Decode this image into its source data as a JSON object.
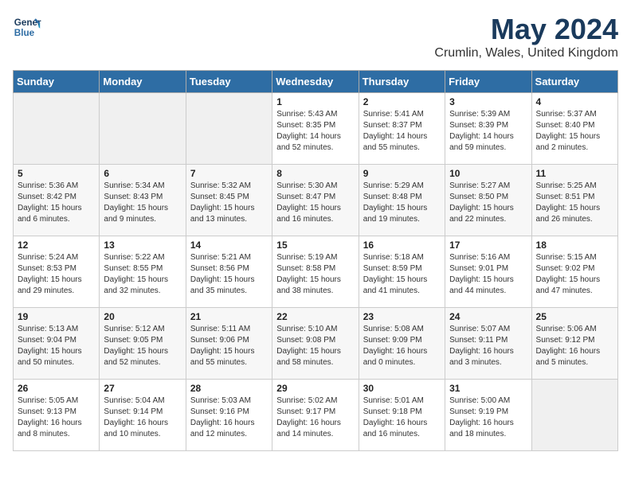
{
  "header": {
    "logo_line1": "General",
    "logo_line2": "Blue",
    "month": "May 2024",
    "location": "Crumlin, Wales, United Kingdom"
  },
  "weekdays": [
    "Sunday",
    "Monday",
    "Tuesday",
    "Wednesday",
    "Thursday",
    "Friday",
    "Saturday"
  ],
  "weeks": [
    [
      {
        "day": "",
        "empty": true
      },
      {
        "day": "",
        "empty": true
      },
      {
        "day": "",
        "empty": true
      },
      {
        "day": "1",
        "sunrise": "Sunrise: 5:43 AM",
        "sunset": "Sunset: 8:35 PM",
        "daylight": "Daylight: 14 hours and 52 minutes."
      },
      {
        "day": "2",
        "sunrise": "Sunrise: 5:41 AM",
        "sunset": "Sunset: 8:37 PM",
        "daylight": "Daylight: 14 hours and 55 minutes."
      },
      {
        "day": "3",
        "sunrise": "Sunrise: 5:39 AM",
        "sunset": "Sunset: 8:39 PM",
        "daylight": "Daylight: 14 hours and 59 minutes."
      },
      {
        "day": "4",
        "sunrise": "Sunrise: 5:37 AM",
        "sunset": "Sunset: 8:40 PM",
        "daylight": "Daylight: 15 hours and 2 minutes."
      }
    ],
    [
      {
        "day": "5",
        "sunrise": "Sunrise: 5:36 AM",
        "sunset": "Sunset: 8:42 PM",
        "daylight": "Daylight: 15 hours and 6 minutes."
      },
      {
        "day": "6",
        "sunrise": "Sunrise: 5:34 AM",
        "sunset": "Sunset: 8:43 PM",
        "daylight": "Daylight: 15 hours and 9 minutes."
      },
      {
        "day": "7",
        "sunrise": "Sunrise: 5:32 AM",
        "sunset": "Sunset: 8:45 PM",
        "daylight": "Daylight: 15 hours and 13 minutes."
      },
      {
        "day": "8",
        "sunrise": "Sunrise: 5:30 AM",
        "sunset": "Sunset: 8:47 PM",
        "daylight": "Daylight: 15 hours and 16 minutes."
      },
      {
        "day": "9",
        "sunrise": "Sunrise: 5:29 AM",
        "sunset": "Sunset: 8:48 PM",
        "daylight": "Daylight: 15 hours and 19 minutes."
      },
      {
        "day": "10",
        "sunrise": "Sunrise: 5:27 AM",
        "sunset": "Sunset: 8:50 PM",
        "daylight": "Daylight: 15 hours and 22 minutes."
      },
      {
        "day": "11",
        "sunrise": "Sunrise: 5:25 AM",
        "sunset": "Sunset: 8:51 PM",
        "daylight": "Daylight: 15 hours and 26 minutes."
      }
    ],
    [
      {
        "day": "12",
        "sunrise": "Sunrise: 5:24 AM",
        "sunset": "Sunset: 8:53 PM",
        "daylight": "Daylight: 15 hours and 29 minutes."
      },
      {
        "day": "13",
        "sunrise": "Sunrise: 5:22 AM",
        "sunset": "Sunset: 8:55 PM",
        "daylight": "Daylight: 15 hours and 32 minutes."
      },
      {
        "day": "14",
        "sunrise": "Sunrise: 5:21 AM",
        "sunset": "Sunset: 8:56 PM",
        "daylight": "Daylight: 15 hours and 35 minutes."
      },
      {
        "day": "15",
        "sunrise": "Sunrise: 5:19 AM",
        "sunset": "Sunset: 8:58 PM",
        "daylight": "Daylight: 15 hours and 38 minutes."
      },
      {
        "day": "16",
        "sunrise": "Sunrise: 5:18 AM",
        "sunset": "Sunset: 8:59 PM",
        "daylight": "Daylight: 15 hours and 41 minutes."
      },
      {
        "day": "17",
        "sunrise": "Sunrise: 5:16 AM",
        "sunset": "Sunset: 9:01 PM",
        "daylight": "Daylight: 15 hours and 44 minutes."
      },
      {
        "day": "18",
        "sunrise": "Sunrise: 5:15 AM",
        "sunset": "Sunset: 9:02 PM",
        "daylight": "Daylight: 15 hours and 47 minutes."
      }
    ],
    [
      {
        "day": "19",
        "sunrise": "Sunrise: 5:13 AM",
        "sunset": "Sunset: 9:04 PM",
        "daylight": "Daylight: 15 hours and 50 minutes."
      },
      {
        "day": "20",
        "sunrise": "Sunrise: 5:12 AM",
        "sunset": "Sunset: 9:05 PM",
        "daylight": "Daylight: 15 hours and 52 minutes."
      },
      {
        "day": "21",
        "sunrise": "Sunrise: 5:11 AM",
        "sunset": "Sunset: 9:06 PM",
        "daylight": "Daylight: 15 hours and 55 minutes."
      },
      {
        "day": "22",
        "sunrise": "Sunrise: 5:10 AM",
        "sunset": "Sunset: 9:08 PM",
        "daylight": "Daylight: 15 hours and 58 minutes."
      },
      {
        "day": "23",
        "sunrise": "Sunrise: 5:08 AM",
        "sunset": "Sunset: 9:09 PM",
        "daylight": "Daylight: 16 hours and 0 minutes."
      },
      {
        "day": "24",
        "sunrise": "Sunrise: 5:07 AM",
        "sunset": "Sunset: 9:11 PM",
        "daylight": "Daylight: 16 hours and 3 minutes."
      },
      {
        "day": "25",
        "sunrise": "Sunrise: 5:06 AM",
        "sunset": "Sunset: 9:12 PM",
        "daylight": "Daylight: 16 hours and 5 minutes."
      }
    ],
    [
      {
        "day": "26",
        "sunrise": "Sunrise: 5:05 AM",
        "sunset": "Sunset: 9:13 PM",
        "daylight": "Daylight: 16 hours and 8 minutes."
      },
      {
        "day": "27",
        "sunrise": "Sunrise: 5:04 AM",
        "sunset": "Sunset: 9:14 PM",
        "daylight": "Daylight: 16 hours and 10 minutes."
      },
      {
        "day": "28",
        "sunrise": "Sunrise: 5:03 AM",
        "sunset": "Sunset: 9:16 PM",
        "daylight": "Daylight: 16 hours and 12 minutes."
      },
      {
        "day": "29",
        "sunrise": "Sunrise: 5:02 AM",
        "sunset": "Sunset: 9:17 PM",
        "daylight": "Daylight: 16 hours and 14 minutes."
      },
      {
        "day": "30",
        "sunrise": "Sunrise: 5:01 AM",
        "sunset": "Sunset: 9:18 PM",
        "daylight": "Daylight: 16 hours and 16 minutes."
      },
      {
        "day": "31",
        "sunrise": "Sunrise: 5:00 AM",
        "sunset": "Sunset: 9:19 PM",
        "daylight": "Daylight: 16 hours and 18 minutes."
      },
      {
        "day": "",
        "empty": true
      }
    ]
  ]
}
